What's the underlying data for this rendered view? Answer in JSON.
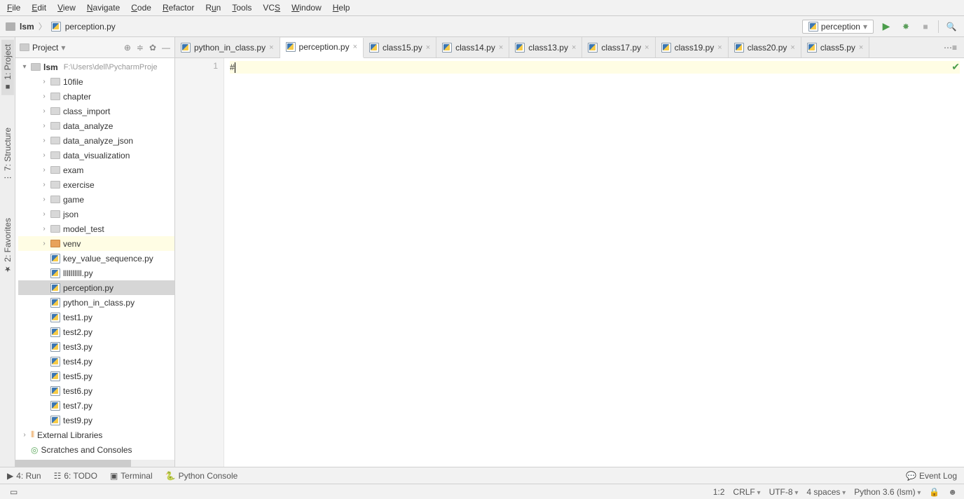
{
  "menu": [
    "File",
    "Edit",
    "View",
    "Navigate",
    "Code",
    "Refactor",
    "Run",
    "Tools",
    "VCS",
    "Window",
    "Help"
  ],
  "breadcrumb": {
    "root": "lsm",
    "file": "perception.py"
  },
  "runConfig": "perception",
  "projectPane": {
    "title": "Project"
  },
  "tree": {
    "root": {
      "name": "lsm",
      "path": "F:\\Users\\dell\\PycharmProje"
    },
    "folders": [
      "10file",
      "chapter",
      "class_import",
      "data_analyze",
      "data_analyze_json",
      "data_visualization",
      "exam",
      "exercise",
      "game",
      "json",
      "model_test"
    ],
    "venv": "venv",
    "files": [
      "key_value_sequence.py",
      "llllllllll.py",
      "perception.py",
      "python_in_class.py",
      "test1.py",
      "test2.py",
      "test3.py",
      "test4.py",
      "test5.py",
      "test6.py",
      "test7.py",
      "test9.py"
    ],
    "selectedFile": "perception.py",
    "externalLib": "External Libraries",
    "scratches": "Scratches and Consoles"
  },
  "tabs": [
    "python_in_class.py",
    "perception.py",
    "class15.py",
    "class14.py",
    "class13.py",
    "class17.py",
    "class19.py",
    "class20.py",
    "class5.py"
  ],
  "activeTab": "perception.py",
  "editor": {
    "line": "1",
    "content": "#"
  },
  "toolWindows": {
    "run": "4: Run",
    "todo": "6: TODO",
    "terminal": "Terminal",
    "pyconsole": "Python Console",
    "eventlog": "Event Log"
  },
  "leftTabs": {
    "project": "1: Project",
    "structure": "7: Structure",
    "favorites": "2: Favorites"
  },
  "status": {
    "pos": "1:2",
    "lineEnd": "CRLF",
    "encoding": "UTF-8",
    "indent": "4 spaces",
    "interpreter": "Python 3.6 (lsm)"
  }
}
